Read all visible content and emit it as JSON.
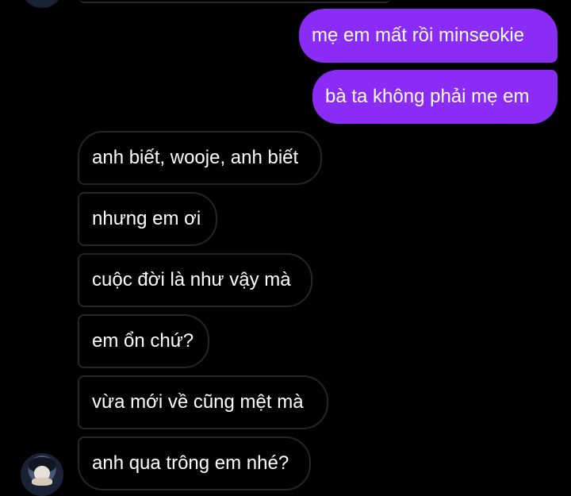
{
  "conversation": {
    "sent_messages": [
      "mẹ em mất rồi minseokie",
      "bà ta không phải mẹ em"
    ],
    "received_messages": [
      "anh biết, wooje, anh biết",
      "nhưng em ơi",
      "cuộc đời là như vậy mà",
      "em ổn chứ?",
      "vừa mới về cũng mệt mà",
      "anh qua trông em nhé?"
    ]
  },
  "colors": {
    "background": "#000000",
    "sent_bubble": "#8a2cf5",
    "received_border": "#262626",
    "text": "#ffffff"
  }
}
